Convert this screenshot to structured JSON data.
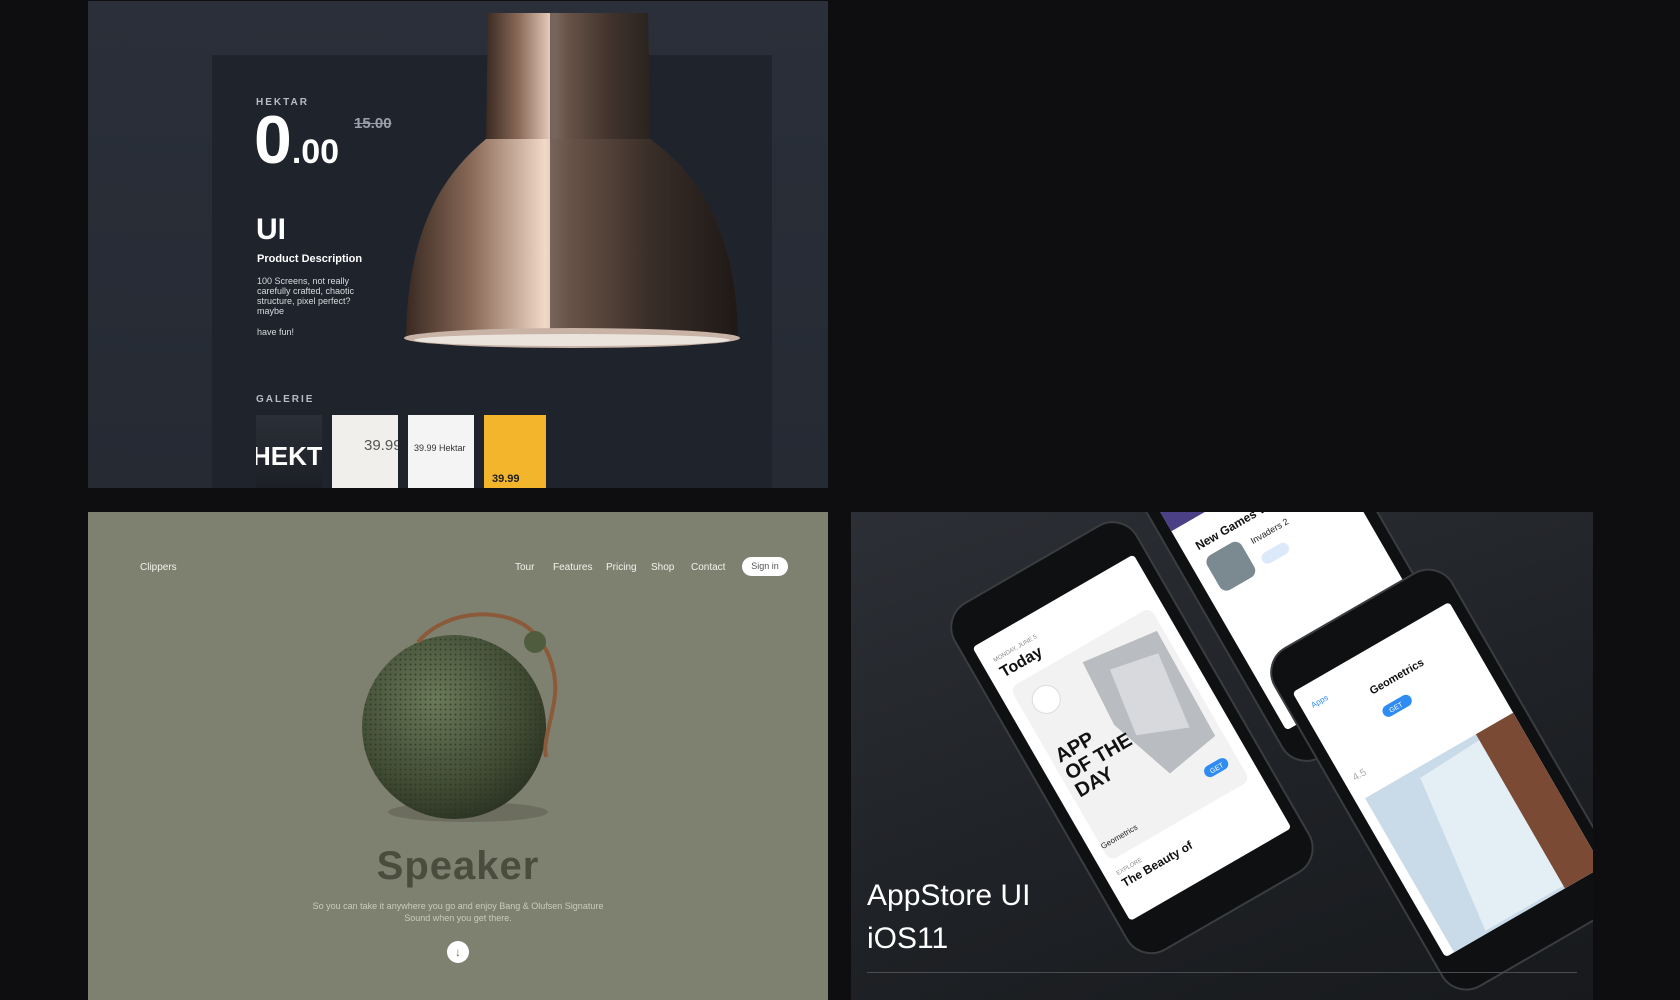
{
  "hektar": {
    "brand": "HEKTAR",
    "price_main": "0",
    "price_decimal": ".00",
    "old_price": "15.00",
    "ui_label": "UI",
    "desc_title": "Product Description",
    "description": "100 Screens, not really carefully crafted, chaotic structure, pixel perfect? maybe",
    "fun": "have fun!",
    "gallery_title": "GALERIE",
    "thumbs": [
      "HEKT",
      "39.99",
      "39.99 Hektar",
      "39.99"
    ]
  },
  "speaker": {
    "logo": "Clippers",
    "nav": [
      "Tour",
      "Features",
      "Pricing",
      "Shop",
      "Contact"
    ],
    "signin": "Sign in",
    "title": "Speaker",
    "subtitle": "So you can take it anywhere you go and enjoy Bang & Olufsen Signature Sound when you get there."
  },
  "appstore": {
    "title_line1": "AppStore UI",
    "title_line2": "iOS11",
    "phone_today": "Today",
    "phone_today_date": "MONDAY, JUNE 5",
    "phone_app_of_day": [
      "APP",
      "OF THE",
      "DAY"
    ],
    "phone_games": "New Games We Love",
    "phone_game_name": "Invaders 2",
    "phone_detail_title": "Geometrics",
    "phone_get": "GET",
    "phone_back": "Apps",
    "phone_rating": "4.5",
    "phone_explore": "EXPLORE",
    "phone_beauty": "The Beauty of"
  },
  "colors": {
    "hektar_bg": "#2a2f39",
    "speaker_bg": "#7f8170",
    "appstore_bg": "#23262b",
    "accent_blue": "#2f8cf2"
  }
}
